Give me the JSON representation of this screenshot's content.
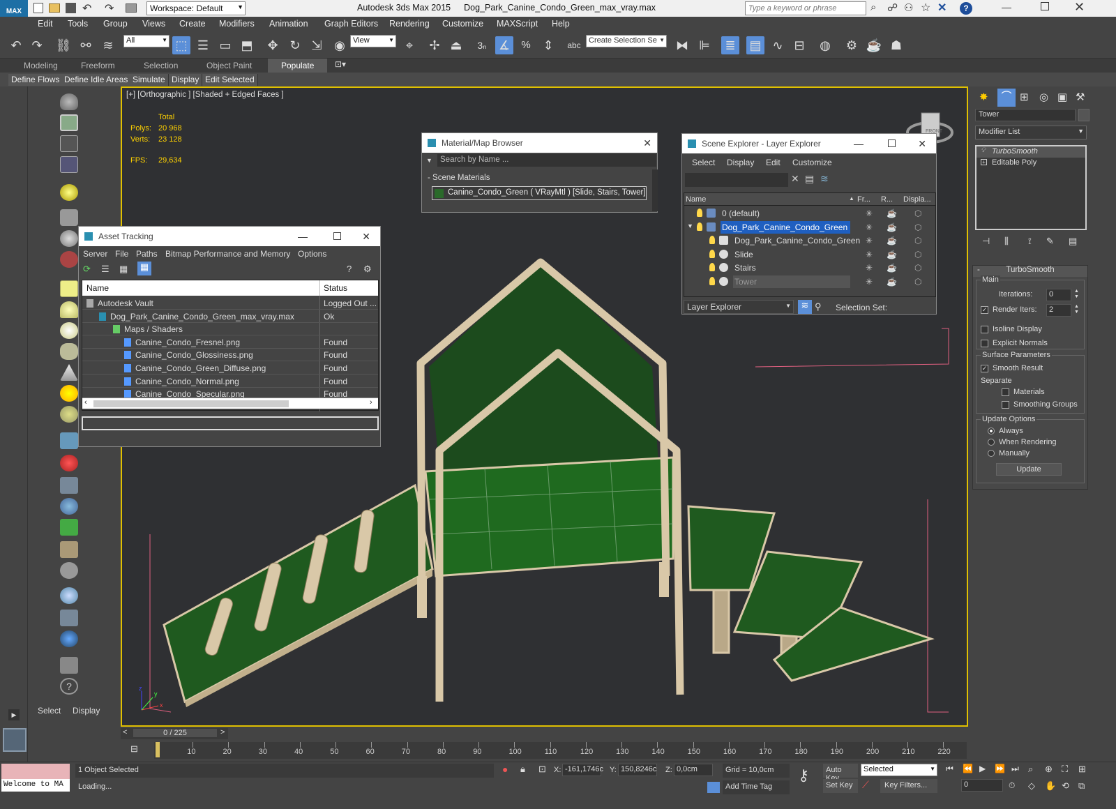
{
  "titlebar": {
    "app_title": "Autodesk 3ds Max  2015",
    "file_name": "Dog_Park_Canine_Condo_Green_max_vray.max",
    "workspace": "Workspace: Default",
    "search_placeholder": "Type a keyword or phrase",
    "logo_text": "MAX"
  },
  "menu": [
    "Edit",
    "Tools",
    "Group",
    "Views",
    "Create",
    "Modifiers",
    "Animation",
    "Graph Editors",
    "Rendering",
    "Customize",
    "MAXScript",
    "Help"
  ],
  "toolbar": {
    "selection_filter": "All",
    "ref_coord": "View",
    "named_selection": "Create Selection Se",
    "snap_label": "3"
  },
  "ribbon": {
    "tabs": [
      "Modeling",
      "Freeform",
      "Selection",
      "Object Paint",
      "Populate"
    ],
    "active_tab": "Populate",
    "buttons": [
      "Define Flows",
      "Define Idle Areas",
      "Simulate",
      "Display",
      "Edit Selected"
    ]
  },
  "viewport": {
    "label": "[+] [Orthographic ] [Shaded + Edged Faces ]",
    "stats": {
      "total_label": "Total",
      "polys_label": "Polys:",
      "polys": "20 968",
      "verts_label": "Verts:",
      "verts": "23 128",
      "fps_label": "FPS:",
      "fps": "29,634"
    },
    "viewcube_label": "FRONT",
    "axis_x": "x",
    "axis_y": "y",
    "axis_z": "z"
  },
  "asset_tracking": {
    "title": "Asset Tracking",
    "menu": [
      "Server",
      "File",
      "Paths",
      "Bitmap Performance and Memory",
      "Options"
    ],
    "col_name": "Name",
    "col_status": "Status",
    "rows": [
      {
        "name": "Autodesk Vault",
        "status": "Logged Out ..."
      },
      {
        "name": "Dog_Park_Canine_Condo_Green_max_vray.max",
        "status": "Ok"
      },
      {
        "name": "Maps / Shaders",
        "status": ""
      },
      {
        "name": "Canine_Condo_Fresnel.png",
        "status": "Found"
      },
      {
        "name": "Canine_Condo_Glossiness.png",
        "status": "Found"
      },
      {
        "name": "Canine_Condo_Green_Diffuse.png",
        "status": "Found"
      },
      {
        "name": "Canine_Condo_Normal.png",
        "status": "Found"
      },
      {
        "name": "Canine_Condo_Specular.png",
        "status": "Found"
      }
    ]
  },
  "material_browser": {
    "title": "Material/Map Browser",
    "search_placeholder": "Search by Name ...",
    "group_label": "- Scene Materials",
    "material_item": "Canine_Condo_Green  ( VRayMtl )  [Slide, Stairs, Tower]"
  },
  "scene_explorer": {
    "title": "Scene Explorer - Layer Explorer",
    "menu": [
      "Select",
      "Display",
      "Edit",
      "Customize"
    ],
    "col_name": "Name",
    "col_fr": "Fr...",
    "col_r": "R...",
    "col_disp": "Displa...",
    "rows": [
      {
        "name": "0 (default)",
        "selected": false
      },
      {
        "name": "Dog_Park_Canine_Condo_Green",
        "selected": true
      },
      {
        "name": "Dog_Park_Canine_Condo_Green",
        "selected": false
      },
      {
        "name": "Slide",
        "selected": false
      },
      {
        "name": "Stairs",
        "selected": false
      },
      {
        "name": "Tower",
        "selected": false
      }
    ],
    "footer_explorer": "Layer Explorer",
    "footer_selset": "Selection Set:"
  },
  "modify_panel": {
    "object_name": "Tower",
    "modifier_list": "Modifier List",
    "stack": [
      "TurboSmooth",
      "Editable Poly"
    ],
    "rollout_title": "TurboSmooth",
    "main_label": "Main",
    "iterations_label": "Iterations:",
    "iterations": "0",
    "render_iters_label": "Render Iters:",
    "render_iters": "2",
    "isoline_label": "Isoline Display",
    "explicit_normals_label": "Explicit Normals",
    "surface_params_label": "Surface Parameters",
    "smooth_result_label": "Smooth Result",
    "separate_label": "Separate",
    "materials_label": "Materials",
    "smoothing_groups_label": "Smoothing Groups",
    "update_options_label": "Update Options",
    "always_label": "Always",
    "when_rendering_label": "When Rendering",
    "manually_label": "Manually",
    "update_button": "Update"
  },
  "cmd_panel": {
    "select": "Select",
    "display": "Display"
  },
  "timeline": {
    "frame": "0 / 225",
    "ticks": [
      "10",
      "20",
      "30",
      "40",
      "50",
      "60",
      "70",
      "80",
      "90",
      "100",
      "110",
      "120",
      "130",
      "140",
      "150",
      "160",
      "170",
      "180",
      "190",
      "200",
      "210",
      "220"
    ]
  },
  "status": {
    "maxscript": "Welcome to MA",
    "selected": "1 Object Selected",
    "prompt": "Loading...",
    "x_label": "X:",
    "x": "-161,1746c",
    "y_label": "Y:",
    "y": "150,8246c",
    "z_label": "Z:",
    "z": "0,0cm",
    "grid": "Grid = 10,0cm",
    "add_time_tag": "Add Time Tag",
    "auto_key": "Auto Key",
    "set_key": "Set Key",
    "key_mode": "Selected",
    "key_filters": "Key Filters...",
    "frame_field": "0"
  },
  "colors": {
    "accent": "#5b8fd8",
    "viewport_border": "#e0c000",
    "stats_text": "#ffd200",
    "model_green": "#1f5a1f",
    "model_tan": "#d9c8a8"
  }
}
